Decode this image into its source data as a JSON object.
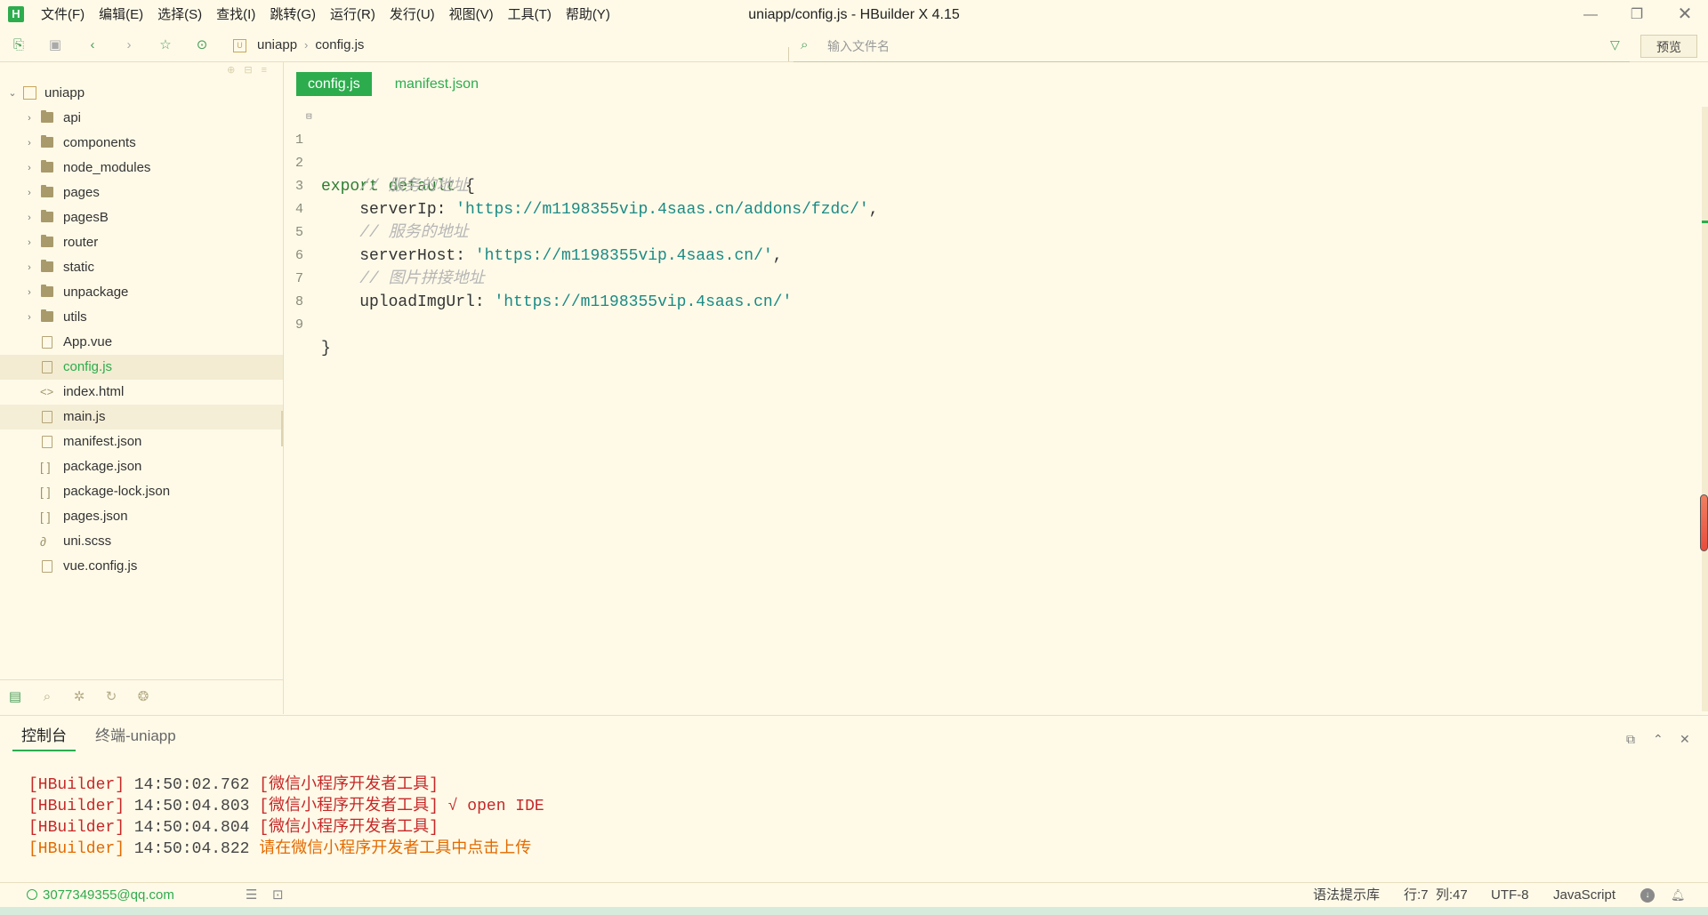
{
  "window": {
    "title": "uniapp/config.js - HBuilder X 4.15",
    "logo_letter": "H",
    "controls": {
      "minimize": "—",
      "maximize": "❐",
      "close": "✕"
    }
  },
  "menu": [
    "文件(F)",
    "编辑(E)",
    "选择(S)",
    "查找(I)",
    "跳转(G)",
    "运行(R)",
    "发行(U)",
    "视图(V)",
    "工具(T)",
    "帮助(Y)"
  ],
  "toolbar": {
    "breadcrumb": [
      "uniapp",
      "config.js"
    ],
    "file_search_placeholder": "输入文件名",
    "preview_label": "预览"
  },
  "sidebar": {
    "root": "uniapp",
    "items": [
      {
        "label": "api",
        "type": "folder"
      },
      {
        "label": "components",
        "type": "folder"
      },
      {
        "label": "node_modules",
        "type": "folder"
      },
      {
        "label": "pages",
        "type": "folder"
      },
      {
        "label": "pagesB",
        "type": "folder"
      },
      {
        "label": "router",
        "type": "folder"
      },
      {
        "label": "static",
        "type": "folder"
      },
      {
        "label": "unpackage",
        "type": "folder"
      },
      {
        "label": "utils",
        "type": "folder"
      },
      {
        "label": "App.vue",
        "type": "file"
      },
      {
        "label": "config.js",
        "type": "file",
        "state": "active"
      },
      {
        "label": "index.html",
        "type": "file"
      },
      {
        "label": "main.js",
        "type": "file",
        "state": "selected"
      },
      {
        "label": "manifest.json",
        "type": "file"
      },
      {
        "label": "package.json",
        "type": "file"
      },
      {
        "label": "package-lock.json",
        "type": "file"
      },
      {
        "label": "pages.json",
        "type": "file"
      },
      {
        "label": "uni.scss",
        "type": "file"
      },
      {
        "label": "vue.config.js",
        "type": "file"
      }
    ]
  },
  "editor": {
    "tabs": [
      {
        "label": "config.js",
        "active": true
      },
      {
        "label": "manifest.json",
        "active": false
      }
    ],
    "lines": [
      {
        "n": "1",
        "kw": "export default",
        "rest": " {"
      },
      {
        "n": "2",
        "comment": "    // 服务的地址"
      },
      {
        "n": "3",
        "key": "    serverIp: ",
        "str": "'https://m1198355vip.4saas.cn/addons/fzdc/'",
        "tail": ","
      },
      {
        "n": "4",
        "comment": "    // 服务的地址"
      },
      {
        "n": "5",
        "key": "    serverHost: ",
        "str": "'https://m1198355vip.4saas.cn/'",
        "tail": ","
      },
      {
        "n": "6",
        "comment": "    // 图片拼接地址"
      },
      {
        "n": "7",
        "key": "    uploadImgUrl: ",
        "str": "'https://m1198355vip.4saas.cn/'",
        "tail": ""
      },
      {
        "n": "8",
        "plain": ""
      },
      {
        "n": "9",
        "plain": "}"
      }
    ]
  },
  "console": {
    "tabs": [
      "控制台",
      "终端-uniapp"
    ],
    "logs": [
      {
        "tag": "[HBuilder]",
        "time": "14:50:02.762",
        "msg": "[微信小程序开发者工具]",
        "color": "red"
      },
      {
        "tag": "[HBuilder]",
        "time": "14:50:04.803",
        "msg": "[微信小程序开发者工具] √ open IDE",
        "color": "red"
      },
      {
        "tag": "[HBuilder]",
        "time": "14:50:04.804",
        "msg": "[微信小程序开发者工具]",
        "color": "red"
      },
      {
        "tag": "[HBuilder]",
        "time": "14:50:04.822",
        "msg": "请在微信小程序开发者工具中点击上传",
        "color": "orange"
      }
    ]
  },
  "status": {
    "user": "3077349355@qq.com",
    "syntax": "语法提示库",
    "position": "行:7  列:47",
    "encoding": "UTF-8",
    "language": "JavaScript"
  },
  "colors": {
    "accent": "#2dac4d",
    "background": "#fffae8",
    "error": "#c62828",
    "warning": "#e36a00"
  }
}
